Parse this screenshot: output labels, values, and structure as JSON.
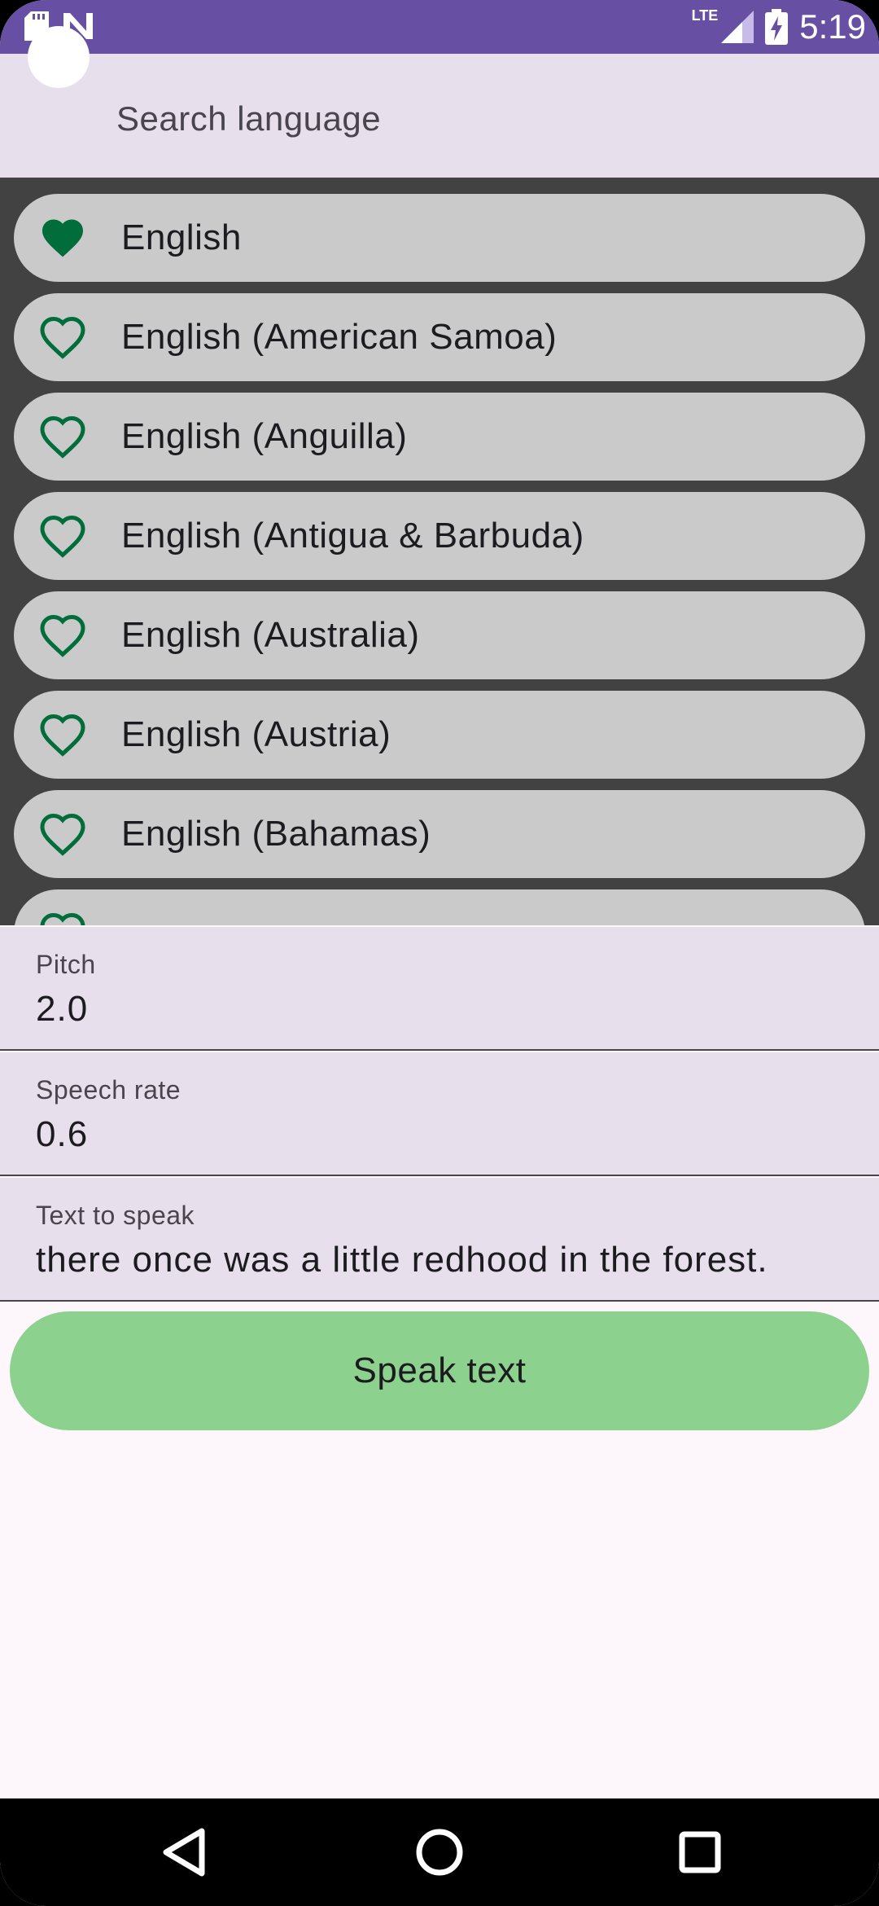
{
  "status_bar": {
    "time": "5:19",
    "network": "LTE",
    "icons": [
      "sd-card-icon",
      "n-icon",
      "signal-icon",
      "battery-charging-icon"
    ],
    "background": "#6750a4"
  },
  "search": {
    "placeholder": "Search language"
  },
  "languages": [
    {
      "label": "English",
      "favorite": true
    },
    {
      "label": "English (American Samoa)",
      "favorite": false
    },
    {
      "label": "English (Anguilla)",
      "favorite": false
    },
    {
      "label": "English (Antigua & Barbuda)",
      "favorite": false
    },
    {
      "label": "English (Australia)",
      "favorite": false
    },
    {
      "label": "English (Austria)",
      "favorite": false
    },
    {
      "label": "English (Bahamas)",
      "favorite": false
    },
    {
      "label": "",
      "favorite": false
    }
  ],
  "fields": {
    "pitch": {
      "label": "Pitch",
      "value": "2.0"
    },
    "speech_rate": {
      "label": "Speech rate",
      "value": "0.6"
    },
    "text_to_speak": {
      "label": "Text to speak",
      "value": "there once was a little redhood in the forest."
    }
  },
  "speak_button": {
    "label": "Speak text"
  },
  "colors": {
    "accent": "#6750a4",
    "heart": "#006d3b",
    "button": "#8cd18d",
    "list_background": "#424242",
    "list_item": "#cacaca"
  },
  "nav_bar": {
    "icons": [
      "back-icon",
      "home-icon",
      "recents-icon"
    ]
  }
}
